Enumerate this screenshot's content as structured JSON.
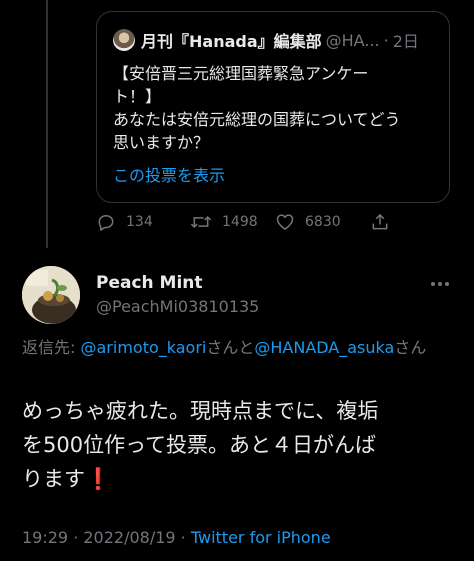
{
  "quote": {
    "author_name": "月刊『Hanada』編集部",
    "handle": "@HA...",
    "dot": "·",
    "time": "2日",
    "body_lines": [
      "【安倍晋三元総理国葬緊急アンケー",
      "ト！】",
      "あなたは安倍元総理の国葬についてどう",
      "思いますか？"
    ],
    "show_poll_label": "この投票を表示"
  },
  "actions": {
    "reply_count": "134",
    "retweet_count": "1498",
    "like_count": "6830"
  },
  "tweet": {
    "author_name": "Peach Mint",
    "handle": "@PeachMi03810135",
    "reply_prefix": "返信先: ",
    "mention_1": "@arimoto_kaori",
    "reply_and": "さんと",
    "mention_2": "@HANADA_asuka",
    "reply_suffix": "さん",
    "text_lines": [
      "めっちゃ疲れた。現時点までに、複垢",
      "を500位作って投票。あと４日がんば",
      "ります"
    ],
    "emoji": "❗",
    "time": "19:29",
    "meta_dot": " · ",
    "date": "2022/08/19",
    "source_sep": " · ",
    "source": "Twitter for iPhone"
  },
  "icons": {
    "reply": "reply-icon",
    "retweet": "retweet-icon",
    "like": "heart-icon",
    "share": "share-icon",
    "more": "more-icon"
  },
  "colors": {
    "background": "#000000",
    "text": "#e7e9ea",
    "muted": "#71767b",
    "link": "#1d9bf0",
    "border": "#2f3336",
    "emoji": "#e0245e"
  }
}
